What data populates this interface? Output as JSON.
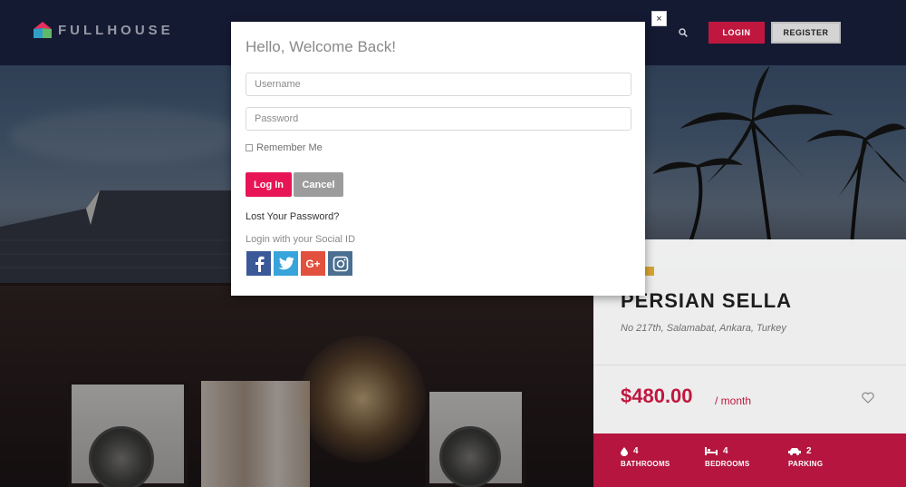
{
  "header": {
    "logo_text": "FULLHOUSE",
    "login_label": "LOGIN",
    "register_label": "REGISTER",
    "icons": [
      "logo-icon",
      "search-icon"
    ]
  },
  "property": {
    "title": "PERSIAN SELLA",
    "address": "No 217th, Salamabat, Ankara, Turkey",
    "price": "$480.00",
    "per": "/ month",
    "features": [
      {
        "icon": "drop-icon",
        "count": "4",
        "label": "BATHROOMS"
      },
      {
        "icon": "bed-icon",
        "count": "4",
        "label": "BEDROOMS"
      },
      {
        "icon": "car-icon",
        "count": "2",
        "label": "PARKING"
      }
    ]
  },
  "modal": {
    "title": "Hello, Welcome Back!",
    "username_placeholder": "Username",
    "password_placeholder": "Password",
    "remember_label": "Remember Me",
    "login_label": "Log In",
    "cancel_label": "Cancel",
    "lost_password": "Lost Your Password?",
    "social_label": "Login with your Social ID",
    "social": [
      "facebook-icon",
      "twitter-icon",
      "google-plus-icon",
      "instagram-icon"
    ],
    "close_label": "×"
  },
  "colors": {
    "header_bg": "#151a33",
    "brand_red": "#c0173f",
    "login_pink": "#e81556",
    "cancel_gray": "#9c9c9c",
    "tag_gold": "#d8a531"
  }
}
